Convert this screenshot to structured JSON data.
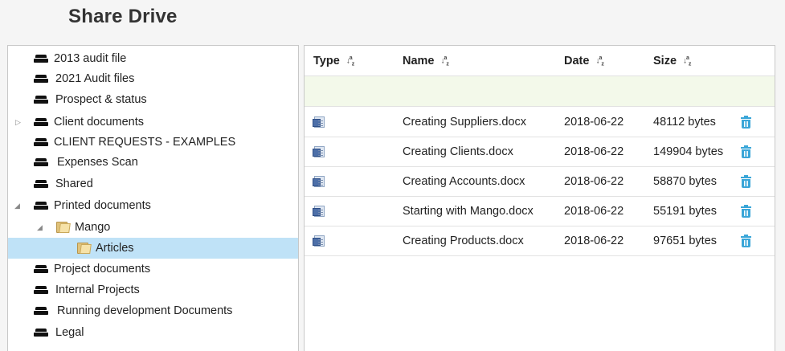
{
  "header": {
    "title": "Share Drive"
  },
  "tree": {
    "items": [
      {
        "label": "2013 audit file",
        "icon": "drive-icon",
        "toggle": ""
      },
      {
        "label": "2021 Audit files",
        "icon": "drive-icon",
        "toggle": ""
      },
      {
        "label": "Prospect & status",
        "icon": "drive-icon",
        "toggle": ""
      },
      {
        "label": "Client documents",
        "icon": "drive-icon",
        "toggle": "▷"
      },
      {
        "label": "CLIENT REQUESTS - EXAMPLES",
        "icon": "drive-icon",
        "toggle": ""
      },
      {
        "label": "Expenses Scan",
        "icon": "drive-icon",
        "toggle": ""
      },
      {
        "label": "Shared",
        "icon": "drive-icon",
        "toggle": ""
      },
      {
        "label": "Printed documents",
        "icon": "drive-icon",
        "toggle": "◢"
      },
      {
        "label": "Mango",
        "icon": "folder-icon",
        "toggle": "◢"
      },
      {
        "label": "Articles",
        "icon": "folder-icon",
        "toggle": "",
        "selected": true
      },
      {
        "label": "Project documents",
        "icon": "drive-icon",
        "toggle": ""
      },
      {
        "label": "Internal Projects",
        "icon": "drive-icon",
        "toggle": ""
      },
      {
        "label": "Running development Documents",
        "icon": "drive-icon",
        "toggle": ""
      },
      {
        "label": "Legal",
        "icon": "drive-icon",
        "toggle": ""
      }
    ]
  },
  "table": {
    "columns": {
      "type": "Type",
      "name": "Name",
      "date": "Date",
      "size": "Size"
    },
    "sort_icon": "↓a z",
    "rows": [
      {
        "name": "Creating Suppliers.docx",
        "date": "2018-06-22",
        "size": "48112 bytes"
      },
      {
        "name": "Creating Clients.docx",
        "date": "2018-06-22",
        "size": "149904 bytes"
      },
      {
        "name": "Creating Accounts.docx",
        "date": "2018-06-22",
        "size": "58870 bytes"
      },
      {
        "name": "Starting with Mango.docx",
        "date": "2018-06-22",
        "size": "55191 bytes"
      },
      {
        "name": "Creating Products.docx",
        "date": "2018-06-22",
        "size": "97651 bytes"
      }
    ]
  },
  "colors": {
    "selected_row": "#bfe2f7",
    "filter_row": "#f3f9ea",
    "trash": "#3aa6d8"
  }
}
